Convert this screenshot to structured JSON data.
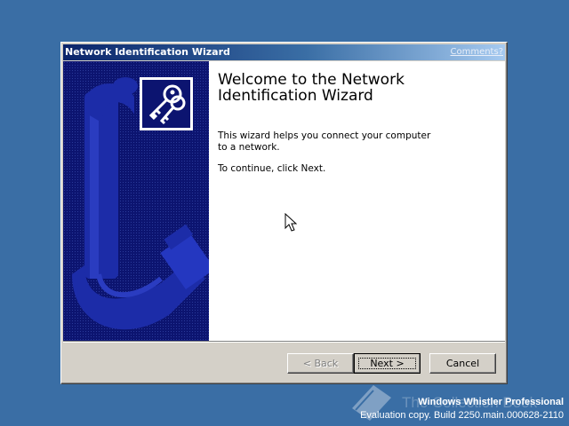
{
  "window": {
    "title": "Network Identification Wizard",
    "comments_link": "Comments?"
  },
  "wizard": {
    "heading": "Welcome to the Network Identification Wizard",
    "description": "This wizard helps you connect your computer to a network.",
    "instruction": "To continue, click Next.",
    "icon": "keys-icon"
  },
  "buttons": {
    "back": "< Back",
    "next": "Next >",
    "cancel": "Cancel"
  },
  "desktop": {
    "ghost_watermark": "The Collection Book",
    "product": "Windows Whistler Professional",
    "build": "Evaluation copy. Build 2250.main.000628-2110"
  },
  "colors": {
    "desktop": "#3a6ea5",
    "titlebar_start": "#0a246a",
    "sidebar": "#0c1470",
    "window_face": "#d4d0c8"
  }
}
